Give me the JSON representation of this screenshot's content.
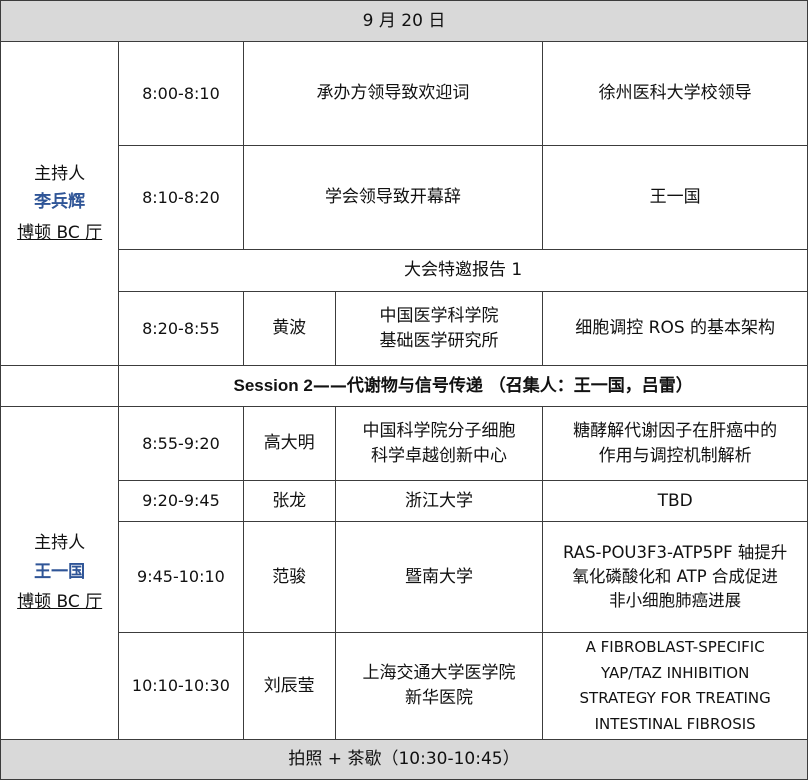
{
  "date_header": "9 月 20 日",
  "block1": {
    "host_label": "主持人",
    "host_name": "李兵辉",
    "room": "博顿 BC 厅",
    "rows": [
      {
        "time": "8:00-8:10",
        "content": "承办方领导致欢迎词",
        "speaker": "徐州医科大学校领导"
      },
      {
        "time": "8:10-8:20",
        "content": "学会领导致开幕辞",
        "speaker": "王一国"
      }
    ],
    "section_title": "大会特邀报告 1",
    "talk": {
      "time": "8:20-8:55",
      "speaker": "黄波",
      "affiliation_lines": [
        "中国医学科学院",
        "基础医学研究所"
      ],
      "title": "细胞调控 ROS 的基本架构"
    }
  },
  "session2": {
    "prefix": "Session 2",
    "rest": "——代谢物与信号传递 （召集人：王一国，吕雷）"
  },
  "block2": {
    "host_label": "主持人",
    "host_name": "王一国",
    "room": "博顿 BC 厅",
    "talks": [
      {
        "time": "8:55-9:20",
        "speaker": "高大明",
        "affiliation_lines": [
          "中国科学院分子细胞",
          "科学卓越创新中心"
        ],
        "title_lines": [
          "糖酵解代谢因子在肝癌中的",
          "作用与调控机制解析"
        ]
      },
      {
        "time": "9:20-9:45",
        "speaker": "张龙",
        "affiliation_lines": [
          "浙江大学"
        ],
        "title_lines": [
          "TBD"
        ]
      },
      {
        "time": "9:45-10:10",
        "speaker": "范骏",
        "affiliation_lines": [
          "暨南大学"
        ],
        "title_lines": [
          "RAS-POU3F3-ATP5PF 轴提升",
          "氧化磷酸化和 ATP 合成促进",
          "非小细胞肺癌进展"
        ]
      },
      {
        "time": "10:10-10:30",
        "speaker": "刘辰莹",
        "affiliation_lines": [
          "上海交通大学医学院",
          "新华医院"
        ],
        "title_lines": [
          "A FIBROBLAST-SPECIFIC",
          "YAP/TAZ INHIBITION",
          "STRATEGY FOR TREATING",
          "INTESTINAL FIBROSIS"
        ]
      }
    ]
  },
  "break": "拍照 + 茶歇（10:30-10:45）"
}
